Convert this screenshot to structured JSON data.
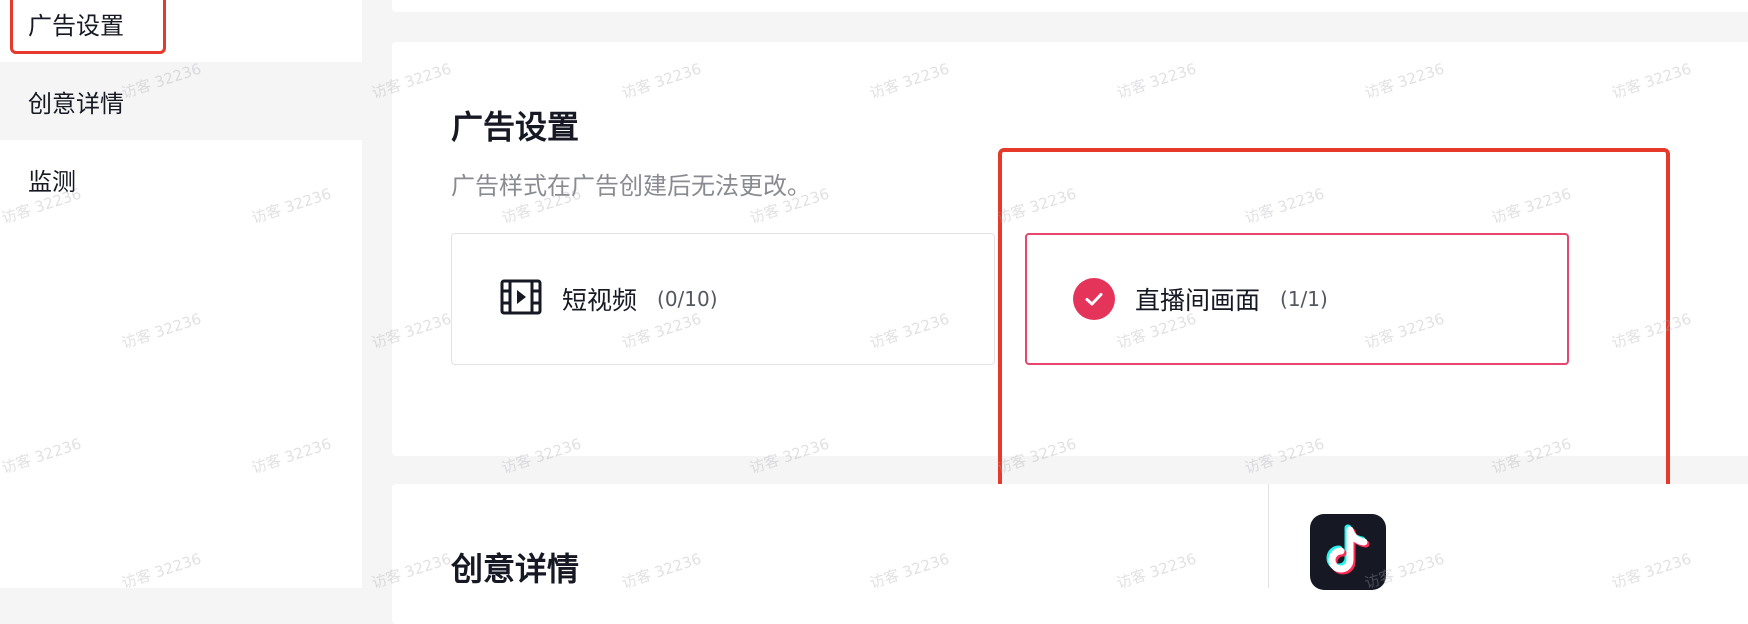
{
  "sidebar": {
    "items": [
      {
        "label": "广告设置"
      },
      {
        "label": "创意详情"
      },
      {
        "label": "监测"
      }
    ]
  },
  "ad_settings": {
    "title": "广告设置",
    "subtitle": "广告样式在广告创建后无法更改。",
    "options": [
      {
        "label": "短视频",
        "count": "(0/10)",
        "icon": "video-icon",
        "selected": false
      },
      {
        "label": "直播间画面",
        "count": "(1/1)",
        "icon": "check-icon",
        "selected": true
      }
    ]
  },
  "creative": {
    "title": "创意详情",
    "logo_icon": "tiktok-logo-icon"
  },
  "watermark": {
    "text": "访客 32236"
  },
  "colors": {
    "accent": "#e5345a",
    "annotation": "#e5392c",
    "selected_border": "#e8456f",
    "background": "#f5f5f5"
  }
}
